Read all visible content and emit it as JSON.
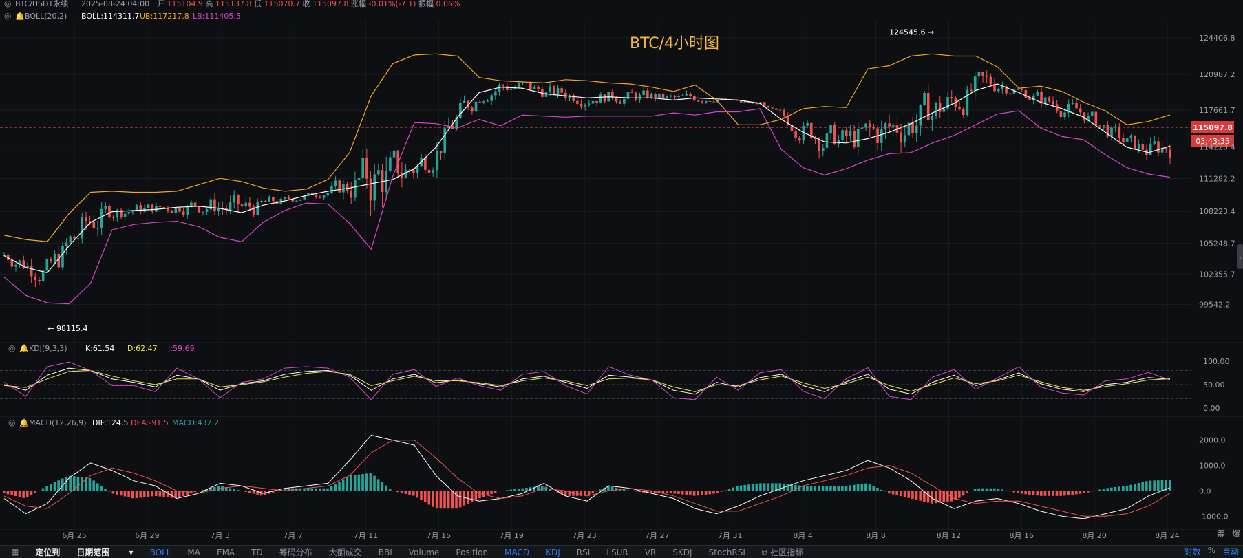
{
  "header": {
    "symbol": "BTC/USDT永续",
    "time": "2025-08-24 04:00",
    "ohlc": [
      {
        "label": "开",
        "value": "115104.9"
      },
      {
        "label": "高",
        "value": "115137.8"
      },
      {
        "label": "低",
        "value": "115070.7"
      },
      {
        "label": "收",
        "value": "115097.8"
      },
      {
        "label": "涨幅",
        "value": "-0.01%(-7.1)"
      },
      {
        "label": "振幅",
        "value": "0.06%"
      }
    ]
  },
  "boll": {
    "name": "BOLL(20,2)",
    "mid": "BOLL:114311.7",
    "ub": "UB:117217.8",
    "lb": "LB:111405.5"
  },
  "kdj": {
    "name": "KDJ(9,3,3)",
    "k": "K:61.54",
    "d": "D:62.47",
    "j": "J:59.69"
  },
  "macd": {
    "name": "MACD(12,26,9)",
    "dif": "DIF:124.5",
    "dea": "DEA:-91.5",
    "macd": "MACD:432.2"
  },
  "main_title": "BTC/4小时图",
  "price_tag": {
    "price": "115097.8",
    "countdown": "03:43:35"
  },
  "colors": {
    "up": "#26a69a",
    "down": "#ef5350",
    "boll_mid": "#ffffff",
    "boll_ub": "#f5a623",
    "boll_lb": "#d946c8",
    "title": "#f5b73b"
  },
  "chart_data": [
    {
      "type": "candlestick",
      "title": "BTC/4小时图",
      "x_ticks": [
        "6月 25",
        "6月 29",
        "7月 3",
        "7月 7",
        "7月 11",
        "7月 15",
        "7月 19",
        "7月 23",
        "7月 27",
        "7月 31",
        "8月 4",
        "8月 8",
        "8月 12",
        "8月 16",
        "8月 20",
        "8月 24"
      ],
      "y_ticks": [
        "124406.8",
        "120987.2",
        "117661.7",
        "114223.4",
        "111282.2",
        "108223.4",
        "105248.7",
        "102355.7",
        "99542.2"
      ],
      "ylim": [
        96500,
        126000
      ],
      "annotations": [
        {
          "text": "124545.6",
          "x": 0.8,
          "value": 124545.6
        },
        {
          "text": "98115.4",
          "x": 0.035,
          "value": 98115.4
        }
      ],
      "last_price": 115097.8,
      "series": [
        {
          "name": "BOLL",
          "values": [
            104100,
            103000,
            102500,
            105000,
            107200,
            108200,
            108300,
            108400,
            108600,
            108700,
            108500,
            108100,
            108800,
            109200,
            109700,
            110100,
            110400,
            110800,
            111200,
            112200,
            114200,
            117000,
            119300,
            119800,
            119700,
            119200,
            119000,
            118800,
            118900,
            118800,
            118800,
            118600,
            118800,
            118700,
            118600,
            118300,
            116800,
            115600,
            114700,
            114600,
            115000,
            115600,
            116400,
            117400,
            118300,
            119500,
            120100,
            119300,
            118400,
            117800,
            117000,
            115600,
            114200,
            113700,
            114311.7
          ]
        },
        {
          "name": "UB",
          "values": [
            106000,
            105600,
            105400,
            108000,
            110000,
            110100,
            110000,
            110000,
            110100,
            110700,
            111300,
            111000,
            110400,
            110100,
            110300,
            111200,
            113700,
            119000,
            122000,
            122800,
            122900,
            122700,
            120700,
            120400,
            120300,
            120200,
            120500,
            120400,
            120200,
            120100,
            119800,
            119400,
            120000,
            118600,
            116300,
            116300,
            116800,
            117800,
            118000,
            117900,
            121500,
            121800,
            122700,
            122900,
            122700,
            122700,
            121700,
            119700,
            119900,
            119400,
            118400,
            117600,
            116300,
            116600,
            117217.8
          ]
        },
        {
          "name": "LB",
          "values": [
            102100,
            100400,
            99700,
            99600,
            101500,
            106500,
            107000,
            107200,
            107300,
            106800,
            105800,
            105400,
            107200,
            108300,
            109000,
            108900,
            107100,
            104700,
            111500,
            116500,
            116400,
            116000,
            116800,
            116200,
            117200,
            117100,
            117000,
            117100,
            117100,
            117100,
            117100,
            117400,
            117200,
            117500,
            117500,
            117800,
            114000,
            112300,
            111600,
            112200,
            113000,
            113600,
            113700,
            114600,
            115300,
            116300,
            117300,
            117600,
            116000,
            115200,
            114900,
            113500,
            112300,
            111700,
            111405.5
          ]
        }
      ]
    },
    {
      "type": "line",
      "title": "KDJ(9,3,3)",
      "y_ticks": [
        "100.00",
        "50.00",
        "0.00"
      ],
      "ylim": [
        -10,
        110
      ],
      "series": [
        {
          "name": "K",
          "values": [
            50,
            38,
            70,
            85,
            80,
            62,
            55,
            45,
            70,
            62,
            38,
            52,
            58,
            72,
            78,
            80,
            70,
            38,
            62,
            72,
            54,
            60,
            52,
            45,
            62,
            68,
            55,
            42,
            70,
            66,
            60,
            38,
            30,
            55,
            45,
            65,
            72,
            48,
            35,
            56,
            72,
            40,
            30,
            55,
            70,
            48,
            60,
            75,
            52,
            40,
            35,
            50,
            55,
            65,
            61.54
          ]
        },
        {
          "name": "D",
          "values": [
            48,
            44,
            62,
            78,
            80,
            68,
            58,
            50,
            62,
            62,
            45,
            50,
            56,
            66,
            74,
            78,
            72,
            48,
            58,
            68,
            58,
            58,
            54,
            48,
            58,
            64,
            58,
            48,
            62,
            64,
            60,
            45,
            35,
            50,
            48,
            60,
            68,
            54,
            42,
            52,
            66,
            48,
            36,
            50,
            64,
            52,
            58,
            70,
            56,
            44,
            38,
            46,
            52,
            60,
            62.47
          ]
        },
        {
          "name": "J",
          "values": [
            55,
            25,
            88,
            98,
            80,
            48,
            48,
            35,
            85,
            62,
            22,
            55,
            62,
            85,
            88,
            85,
            66,
            18,
            72,
            82,
            46,
            64,
            48,
            38,
            72,
            78,
            48,
            30,
            88,
            70,
            60,
            22,
            18,
            66,
            38,
            75,
            82,
            36,
            20,
            62,
            86,
            25,
            18,
            66,
            82,
            40,
            64,
            88,
            45,
            32,
            28,
            58,
            62,
            76,
            59.69
          ]
        }
      ]
    },
    {
      "type": "bar",
      "title": "MACD(12,26,9)",
      "y_ticks": [
        "2000.0",
        "1000.0",
        "0.0",
        "-1000.0"
      ],
      "ylim": [
        -1400,
        2400
      ],
      "series": [
        {
          "name": "DIF",
          "values": [
            -300,
            -900,
            -500,
            500,
            1100,
            800,
            400,
            200,
            -300,
            -100,
            300,
            200,
            -100,
            100,
            200,
            300,
            1200,
            2200,
            2000,
            1800,
            600,
            -200,
            -400,
            -300,
            -100,
            300,
            -200,
            -400,
            200,
            100,
            -100,
            -300,
            -700,
            -900,
            -600,
            -200,
            100,
            400,
            600,
            800,
            1200,
            900,
            400,
            -300,
            -700,
            -400,
            -300,
            -500,
            -800,
            -1000,
            -1100,
            -900,
            -700,
            -200,
            124.5
          ]
        },
        {
          "name": "DEA",
          "values": [
            -200,
            -600,
            -700,
            -100,
            600,
            900,
            700,
            400,
            0,
            -100,
            100,
            200,
            100,
            0,
            100,
            200,
            600,
            1500,
            2000,
            2000,
            1300,
            500,
            -100,
            -300,
            -200,
            100,
            0,
            -200,
            0,
            100,
            0,
            -200,
            -500,
            -800,
            -800,
            -500,
            -200,
            200,
            400,
            600,
            900,
            1000,
            700,
            200,
            -300,
            -500,
            -400,
            -400,
            -600,
            -800,
            -1000,
            -1000,
            -900,
            -600,
            -91.5
          ]
        },
        {
          "name": "MACD",
          "values": [
            -100,
            -300,
            200,
            600,
            500,
            -100,
            -300,
            -200,
            -300,
            0,
            200,
            0,
            -200,
            100,
            100,
            100,
            600,
            700,
            0,
            -200,
            -700,
            -700,
            -300,
            0,
            100,
            200,
            -200,
            -200,
            200,
            0,
            -100,
            -100,
            -200,
            -100,
            200,
            300,
            300,
            200,
            200,
            200,
            300,
            -100,
            -300,
            -500,
            -400,
            100,
            100,
            -100,
            -200,
            -200,
            -100,
            100,
            200,
            400,
            432.2
          ]
        }
      ]
    }
  ],
  "bottombar": {
    "locate": "定位到",
    "range": "日期范围",
    "indicators": [
      "BOLL",
      "MA",
      "EMA",
      "TD",
      "筹码分布",
      "大额成交",
      "BBI",
      "Volume",
      "Position",
      "MACD",
      "KDJ",
      "RSI",
      "LSUR",
      "VR",
      "SKDJ",
      "StochRSI"
    ],
    "community": "社区指标",
    "right": [
      "对数",
      "%",
      "自动"
    ]
  },
  "side_labels": [
    "筹",
    "爆"
  ]
}
